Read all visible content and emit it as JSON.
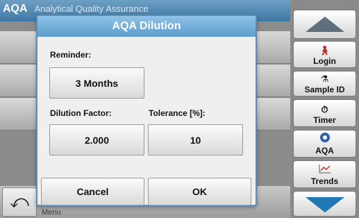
{
  "app": {
    "title": "AQA",
    "subtitle": "Analytical Quality Assurance",
    "menu_label": "Menu"
  },
  "sidebar": {
    "login_label": "Login",
    "sample_id_label": "Sample ID",
    "timer_label": "Timer",
    "aqa_label": "AQA",
    "trends_label": "Trends"
  },
  "dialog": {
    "title": "AQA Dilution",
    "reminder_label": "Reminder:",
    "reminder_value": "3 Months",
    "dilution_label": "Dilution Factor:",
    "dilution_value": "2.000",
    "tolerance_label": "Tolerance [%]:",
    "tolerance_value": "10",
    "cancel_label": "Cancel",
    "ok_label": "OK"
  },
  "icons": {
    "back": "undo-arrow-icon",
    "login": "person-icon",
    "sample_id": "flask-icon",
    "timer": "stopwatch-icon",
    "aqa": "aqa-icon",
    "trends": "trend-chart-icon",
    "up": "triangle-up-icon",
    "down": "triangle-down-icon"
  },
  "colors": {
    "title_blue": "#5f9dcd",
    "dialog_border": "#5a8db8",
    "trend_line": "#c0392b"
  }
}
